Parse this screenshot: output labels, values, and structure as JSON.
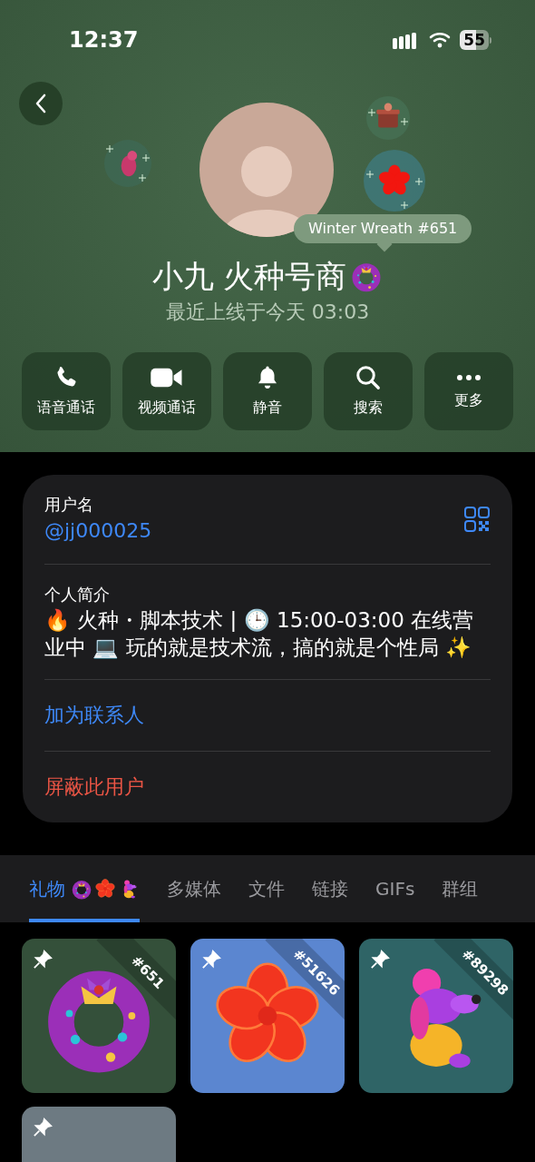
{
  "status_bar": {
    "time": "12:37",
    "battery": "55"
  },
  "profile": {
    "name": "小九 火种号商",
    "last_seen": "最近上线于今天 03:03",
    "gift_tooltip": "Winter Wreath #651"
  },
  "actions": [
    {
      "label": "语音通话",
      "kind": "phone"
    },
    {
      "label": "视频通话",
      "kind": "video"
    },
    {
      "label": "静音",
      "kind": "bell"
    },
    {
      "label": "搜索",
      "kind": "search"
    },
    {
      "label": "更多",
      "kind": "more"
    }
  ],
  "info": {
    "username_label": "用户名",
    "username": "@jj000025",
    "bio_label": "个人简介",
    "bio": "🔥 火种・脚本技术 | 🕒 15:00-03:00 在线营业中 💻 玩的就是技术流，搞的就是个性局 ✨",
    "add_contact": "加为联系人",
    "block": "屏蔽此用户"
  },
  "tabs": [
    {
      "label": "礼物",
      "selected": true
    },
    {
      "label": "多媒体",
      "selected": false
    },
    {
      "label": "文件",
      "selected": false
    },
    {
      "label": "链接",
      "selected": false
    },
    {
      "label": "GIFs",
      "selected": false
    },
    {
      "label": "群组",
      "selected": false
    }
  ],
  "gifts": [
    {
      "kind": "wreath",
      "number": "#651",
      "color": "#34503a",
      "pinned": true
    },
    {
      "kind": "flower",
      "number": "#51626",
      "color": "#5b86d0",
      "pinned": true
    },
    {
      "kind": "dog",
      "number": "#89298",
      "color": "#2f6466",
      "pinned": true
    },
    {
      "kind": "other",
      "color": "#6d7a82",
      "pinned": true
    }
  ]
}
